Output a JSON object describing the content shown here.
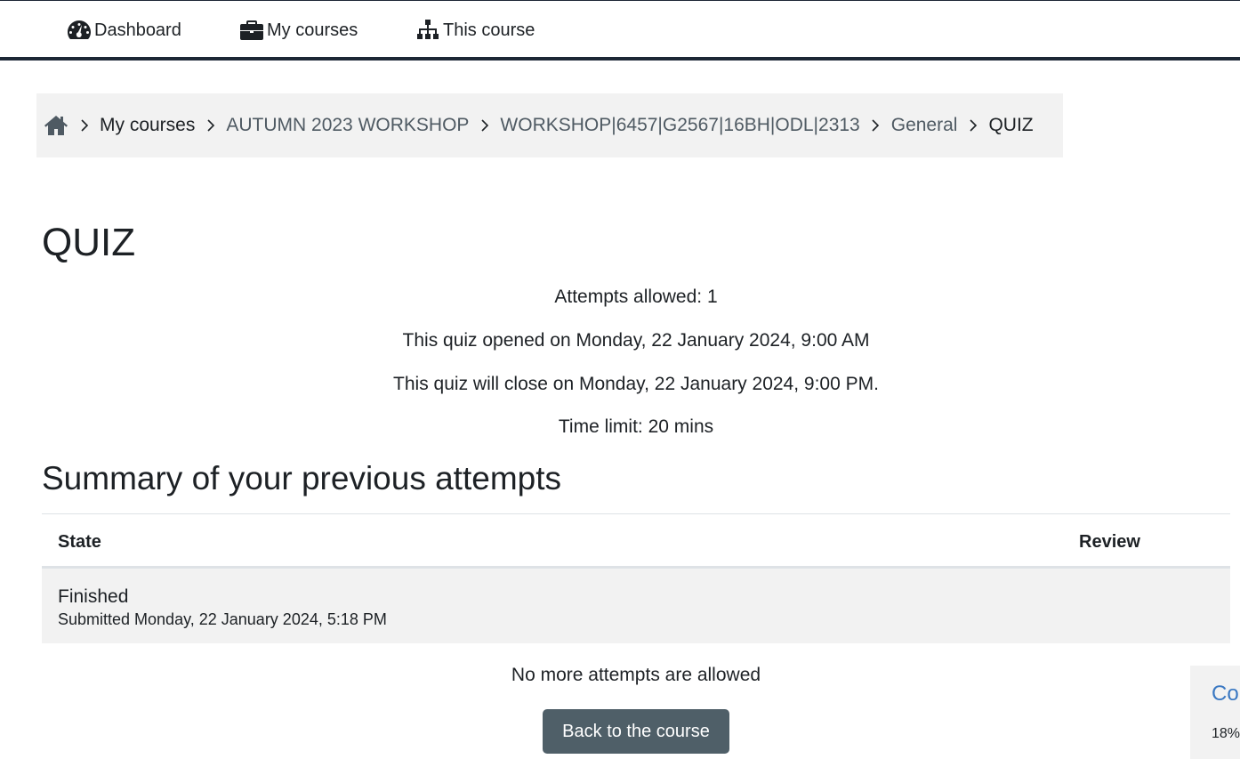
{
  "nav": {
    "dashboard": "Dashboard",
    "my_courses": "My courses",
    "this_course": "This course"
  },
  "breadcrumb": {
    "items": [
      "My courses",
      "AUTUMN 2023 WORKSHOP",
      "WORKSHOP|6457|G2567|16BH|ODL|2313",
      "General"
    ],
    "current": "QUIZ"
  },
  "page": {
    "title": "QUIZ",
    "info": [
      "Attempts allowed: 1",
      "This quiz opened on Monday, 22 January 2024, 9:00 AM",
      "This quiz will close on Monday, 22 January 2024, 9:00 PM.",
      "Time limit: 20 mins"
    ]
  },
  "summary": {
    "title": "Summary of your previous attempts",
    "columns": [
      "State",
      "Review"
    ],
    "rows": [
      {
        "state": "Finished",
        "submitted": "Submitted Monday, 22 January 2024, 5:18 PM"
      }
    ],
    "no_more": "No more attempts are allowed"
  },
  "actions": {
    "back": "Back to the course"
  },
  "side_panel": {
    "link": "Co",
    "percent": "18%"
  },
  "icons": {
    "dashboard": "dashboard-gauge-icon",
    "my_courses": "briefcase-icon",
    "this_course": "sitemap-icon",
    "home": "home-icon",
    "separator": "chevron-right-icon"
  },
  "colors": {
    "nav_border": "#1d2735",
    "button_bg": "#4f5f68",
    "link_blue": "#3a78c2",
    "breadcrumb_bg": "#f2f2f2"
  }
}
